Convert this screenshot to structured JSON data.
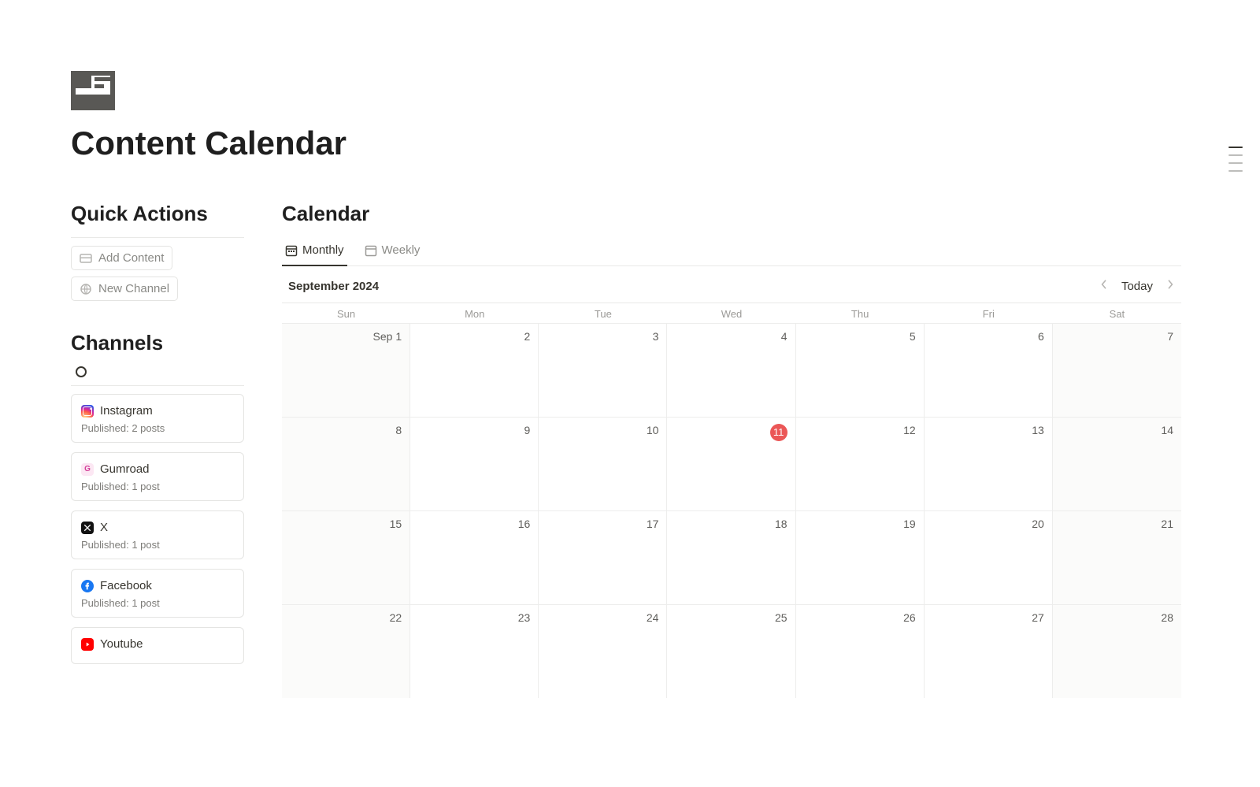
{
  "page": {
    "title": "Content Calendar"
  },
  "sidebar": {
    "quick_actions_title": "Quick Actions",
    "add_content_label": "Add Content",
    "new_channel_label": "New Channel",
    "channels_title": "Channels",
    "channels": [
      {
        "name": "Instagram",
        "sub": "Published: 2 posts",
        "icon": "instagram"
      },
      {
        "name": "Gumroad",
        "sub": "Published: 1 post",
        "icon": "gumroad"
      },
      {
        "name": "X",
        "sub": "Published: 1 post",
        "icon": "x"
      },
      {
        "name": "Facebook",
        "sub": "Published: 1 post",
        "icon": "facebook"
      },
      {
        "name": "Youtube",
        "sub": "",
        "icon": "youtube"
      }
    ]
  },
  "calendar": {
    "section_title": "Calendar",
    "tabs": {
      "monthly": "Monthly",
      "weekly": "Weekly"
    },
    "month_label": "September 2024",
    "today_label": "Today",
    "dow": [
      "Sun",
      "Mon",
      "Tue",
      "Wed",
      "Thu",
      "Fri",
      "Sat"
    ],
    "weeks": [
      [
        "Sep 1",
        "2",
        "3",
        "4",
        "5",
        "6",
        "7"
      ],
      [
        "8",
        "9",
        "10",
        "11",
        "12",
        "13",
        "14"
      ],
      [
        "15",
        "16",
        "17",
        "18",
        "19",
        "20",
        "21"
      ],
      [
        "22",
        "23",
        "24",
        "25",
        "26",
        "27",
        "28"
      ]
    ],
    "today_day": "11",
    "shaded_weekend": true
  }
}
